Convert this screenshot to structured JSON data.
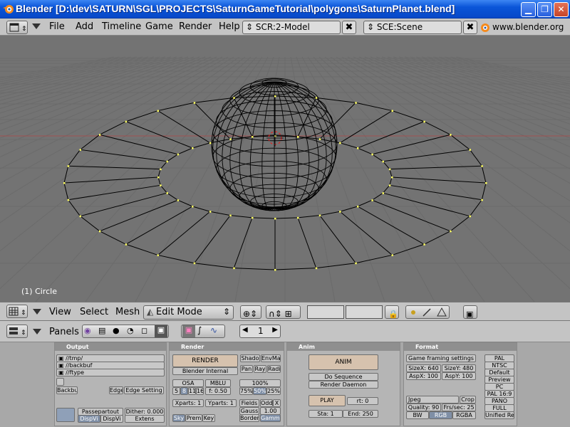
{
  "window": {
    "title": "Blender [D:\\dev\\SATURN\\SGL\\PROJECTS\\SaturnGameTutorial\\polygons\\SaturnPlanet.blend]"
  },
  "menubar": {
    "items": [
      "File",
      "Add",
      "Timeline",
      "Game",
      "Render",
      "Help"
    ],
    "screen": "SCR:2-Model",
    "scene": "SCE:Scene",
    "website": "www.blender.org"
  },
  "viewport": {
    "object_label": "(1) Circle",
    "colors": {
      "background": "#737373",
      "grid": "#6b6b6b",
      "x_axis": "#a05050",
      "wire": "#000000",
      "vertex": "#ffff60"
    }
  },
  "header3d": {
    "menus": [
      "View",
      "Select",
      "Mesh"
    ],
    "mode": "Edit Mode"
  },
  "buttons_header": {
    "panels": "Panels",
    "frame": "1"
  },
  "panels": {
    "output": {
      "title": "Output",
      "paths": [
        "//tmp/",
        "//backbuf",
        "//ftype"
      ],
      "backbuf": "Backbu",
      "edge": "Edge",
      "edge_settings": "Edge Setting",
      "passepartout": "Passepartout",
      "dither": "Dither: 0.000",
      "dispview": "DispVi",
      "dispwin": "DispVi",
      "extens": "Extens"
    },
    "render": {
      "title": "Render",
      "render_btn": "RENDER",
      "engine": "Blender Internal",
      "toggles": [
        "Shado",
        "EnvMa",
        "Pan",
        "Ray",
        "Radi"
      ],
      "osa": "OSA",
      "osa_levels": [
        "5",
        "8",
        "11",
        "16"
      ],
      "mblur": "MBLU",
      "blur_factor": "f: 0.50",
      "size_pct": "100%",
      "size_opts": [
        "75%",
        "50%",
        "25%"
      ],
      "xparts": "Xparts: 1",
      "yparts": "Yparts: 1",
      "fields": "Fields",
      "odd": "Odd",
      "x": "X",
      "gauss": "Gauss",
      "gauss_val": "1.00",
      "sky": "Sky",
      "premul": "Prem",
      "key": "Key",
      "border": "Border",
      "gamma": "Gamma"
    },
    "anim": {
      "title": "Anim",
      "anim_btn": "ANIM",
      "do_sequence": "Do Sequence",
      "render_daemon": "Render Daemon",
      "play": "PLAY",
      "rt": "rt: 0",
      "sta": "Sta: 1",
      "end": "End: 250"
    },
    "format": {
      "title": "Format",
      "game_framing": "Game framing settings",
      "sizex": "SizeX: 640",
      "sizey": "SizeY: 480",
      "aspx": "AspX: 100",
      "aspy": "AspY: 100",
      "format": "Jpeg",
      "crop": "Crop",
      "quality": "Quality: 90",
      "fps": "Frs/sec: 25",
      "bw": "BW",
      "rgb": "RGB",
      "rgba": "RGBA",
      "presets": [
        "PAL",
        "NTSC",
        "Default",
        "Preview",
        "PC",
        "PAL 16:9",
        "PANO",
        "FULL",
        "Unified Re"
      ]
    }
  }
}
